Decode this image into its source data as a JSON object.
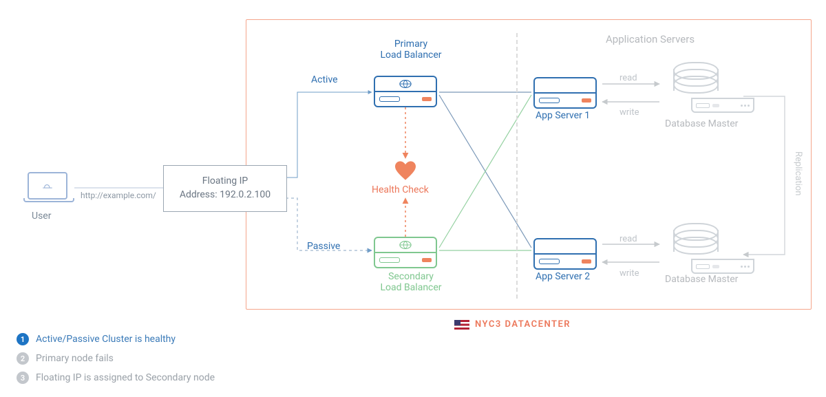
{
  "user_label": "User",
  "url": "http://example.com/",
  "floating_ip": {
    "line1": "Floating IP",
    "line2": "Address: 192.0.2.100"
  },
  "lb_primary": {
    "title_l1": "Primary",
    "title_l2": "Load Balancer",
    "state": "Active"
  },
  "lb_secondary": {
    "title_l1": "Secondary",
    "title_l2": "Load Balancer",
    "state": "Passive"
  },
  "health_check": "Health Check",
  "app_section": "Application Servers",
  "app1": "App Server 1",
  "app2": "App Server 2",
  "db_label": "Database Master",
  "rw": {
    "read": "read",
    "write": "write"
  },
  "replication": "Replication",
  "datacenter": "NYC3 DATACENTER",
  "legend": {
    "items": [
      {
        "n": "1",
        "text": "Active/Passive Cluster is healthy",
        "active": true
      },
      {
        "n": "2",
        "text": "Primary node fails",
        "active": false
      },
      {
        "n": "3",
        "text": "Floating IP is assigned to Secondary node",
        "active": false
      }
    ]
  }
}
